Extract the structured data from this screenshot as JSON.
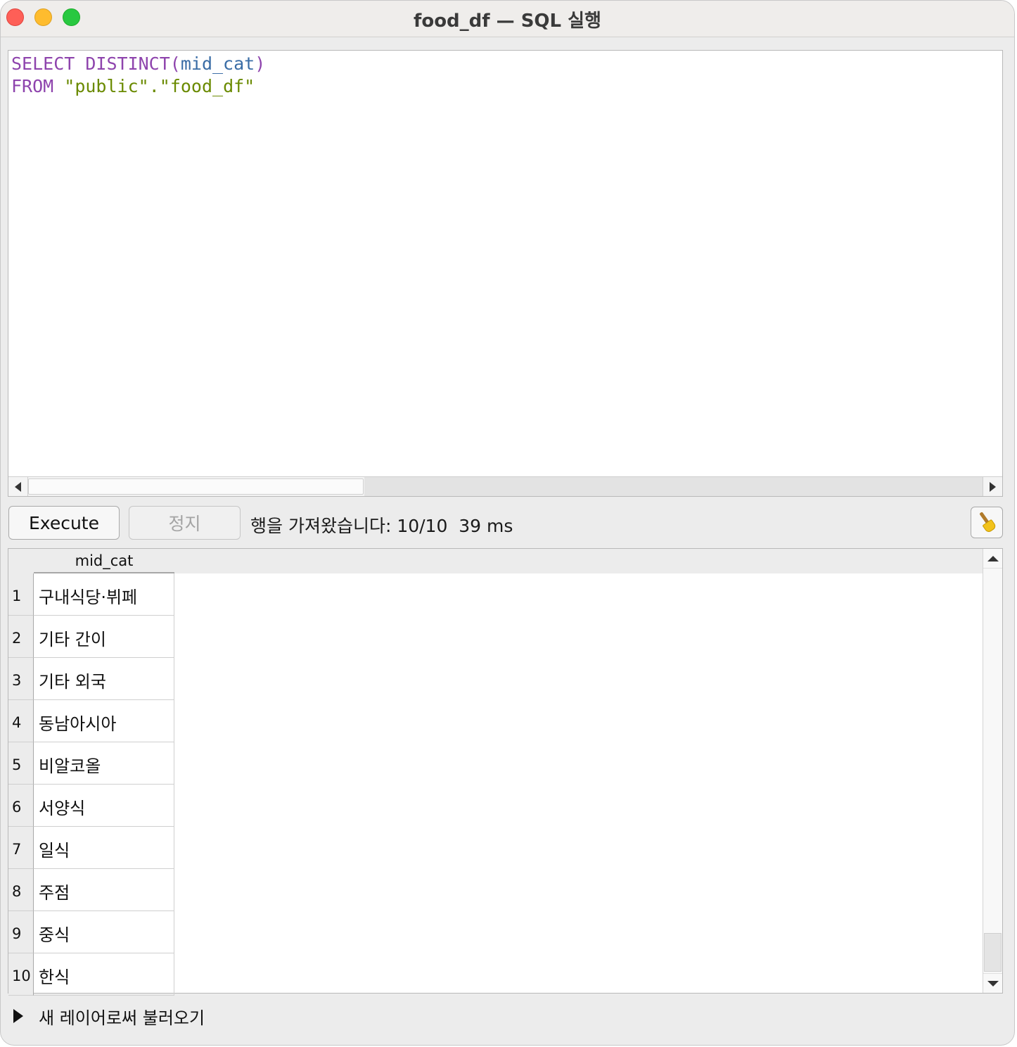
{
  "window": {
    "title": "food_df — SQL 실행"
  },
  "editor": {
    "line1": {
      "kw": "SELECT DISTINCT",
      "open": "(",
      "ident": "mid_cat",
      "close": ")"
    },
    "line2": {
      "kw": "FROM",
      "space": " ",
      "schema": "\"public\"",
      "dot": ".",
      "table": "\"food_df\""
    }
  },
  "toolbar": {
    "execute_label": "Execute",
    "stop_label": "정지",
    "status_text": "행을 가져왔습니다: 10/10  39 ms",
    "clear_icon": "broom-icon"
  },
  "results": {
    "columns": [
      "mid_cat"
    ],
    "rows": [
      {
        "num": "1",
        "mid_cat": "구내식당·뷔페"
      },
      {
        "num": "2",
        "mid_cat": "기타 간이"
      },
      {
        "num": "3",
        "mid_cat": "기타 외국"
      },
      {
        "num": "4",
        "mid_cat": "동남아시아"
      },
      {
        "num": "5",
        "mid_cat": "비알코올"
      },
      {
        "num": "6",
        "mid_cat": "서양식"
      },
      {
        "num": "7",
        "mid_cat": "일식"
      },
      {
        "num": "8",
        "mid_cat": "주점"
      },
      {
        "num": "9",
        "mid_cat": "중식"
      },
      {
        "num": "10",
        "mid_cat": "한식"
      }
    ]
  },
  "expander": {
    "label": "새 레이어로써 불러오기"
  },
  "colors": {
    "keyword": "#8e44ad",
    "identifier": "#3a6da6",
    "string": "#6a8a00",
    "close": "#fe5f57",
    "minimize": "#febc2e",
    "maximize": "#28c840"
  }
}
